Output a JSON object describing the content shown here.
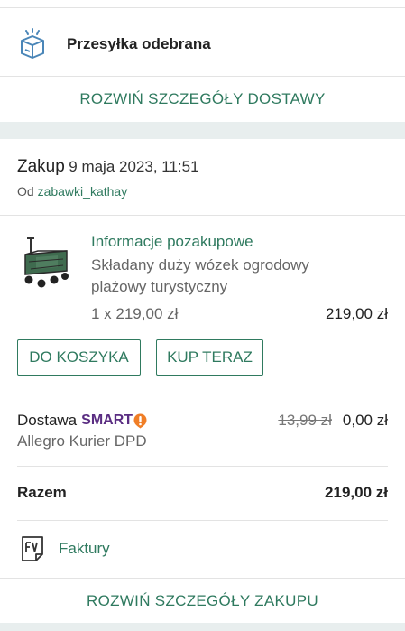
{
  "delivery": {
    "status_title": "Przesyłka odebrana",
    "expand_label": "ROZWIŃ SZCZEGÓŁY DOSTAWY"
  },
  "purchase": {
    "label": "Zakup",
    "date": "9 maja 2023, 11:51",
    "seller_prefix": "Od",
    "seller_name": "zabawki_kathay"
  },
  "product": {
    "after_purchase_info": "Informacje pozakupowe",
    "name": "Składany duży wózek ogrodowy plażowy turystyczny",
    "quantity_price": "1 x 219,00 zł",
    "line_total": "219,00 zł",
    "image_icon": "garden-cart-image"
  },
  "actions": {
    "add_to_cart": "DO KOSZYKA",
    "buy_now": "KUP TERAZ"
  },
  "shipping": {
    "label": "Dostawa",
    "smart_label": "SMART",
    "old_price": "13,99 zł",
    "new_price": "0,00 zł",
    "carrier": "Allegro Kurier DPD"
  },
  "summary": {
    "label": "Razem",
    "total": "219,00 zł"
  },
  "invoice": {
    "label": "Faktury",
    "icon": "invoice-icon"
  },
  "footer": {
    "expand_label": "ROZWIŃ SZCZEGÓŁY ZAKUPU"
  },
  "colors": {
    "accent": "#2f7a5f",
    "smart_purple": "#5a2d82",
    "smart_orange": "#f07e26",
    "background": "#e8eeee"
  }
}
